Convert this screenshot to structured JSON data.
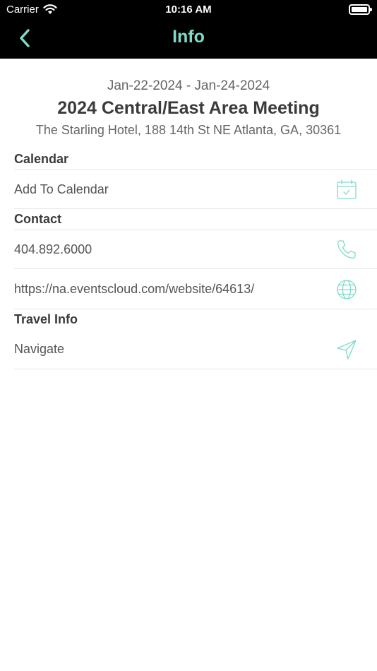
{
  "status_bar": {
    "carrier": "Carrier",
    "time": "10:16 AM"
  },
  "nav": {
    "title": "Info",
    "back_icon": "chevron-left-icon"
  },
  "event": {
    "dates": "Jan-22-2024 - Jan-24-2024",
    "title": "2024 Central/East Area Meeting",
    "address": "The Starling Hotel, 188 14th St NE Atlanta, GA, 30361"
  },
  "sections": {
    "calendar": {
      "label": "Calendar",
      "add_to_calendar": "Add To Calendar"
    },
    "contact": {
      "label": "Contact",
      "phone": "404.892.6000",
      "website": "https://na.eventscloud.com/website/64613/"
    },
    "travel": {
      "label": "Travel Info",
      "navigate": "Navigate"
    }
  },
  "colors": {
    "accent": "#7fdac9",
    "bar_background": "#000000"
  }
}
